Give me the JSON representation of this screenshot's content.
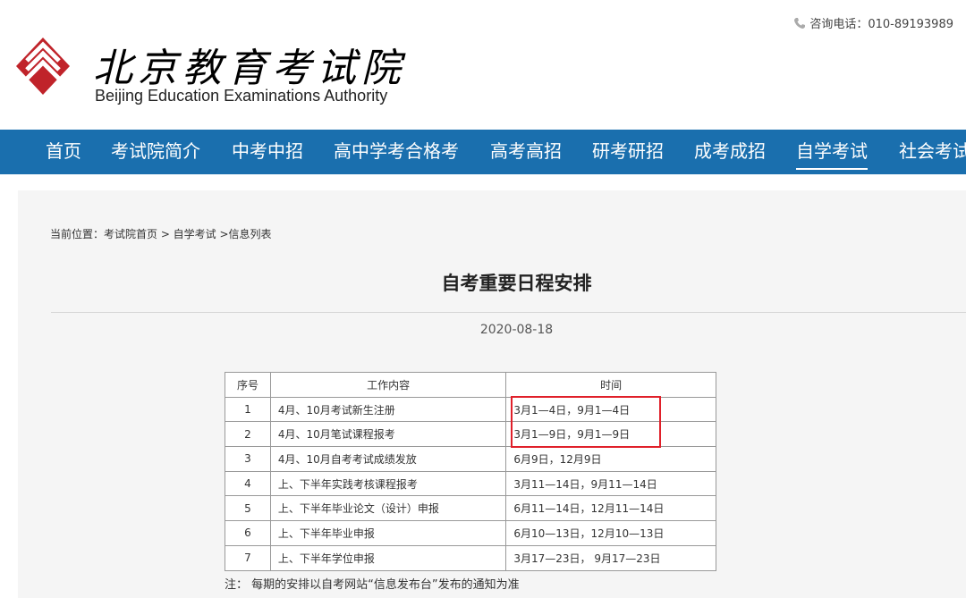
{
  "header": {
    "logo_cn": "北京教育考试院",
    "logo_en": "Beijing Education Examinations Authority",
    "phone": "咨询电话：010-89193989",
    "brand_color": "#c0232a"
  },
  "nav": {
    "items": [
      {
        "label": "首页"
      },
      {
        "label": "考试院简介"
      },
      {
        "label": "中考中招"
      },
      {
        "label": "高中学考合格考"
      },
      {
        "label": "高考高招"
      },
      {
        "label": "研考研招"
      },
      {
        "label": "成考成招"
      },
      {
        "label": "自学考试",
        "active": true
      },
      {
        "label": "社会考试"
      }
    ],
    "color": "#1a6fae"
  },
  "breadcrumb": "当前位置：考试院首页 > 自学考试 >信息列表",
  "article": {
    "title": "自考重要日程安排",
    "date": "2020-08-18"
  },
  "table": {
    "headers": [
      "序号",
      "工作内容",
      "时间"
    ],
    "rows": [
      [
        "1",
        "4月、10月考试新生注册",
        "3月1—4日，9月1—4日"
      ],
      [
        "2",
        "4月、10月笔试课程报考",
        "3月1—9日，9月1—9日"
      ],
      [
        "3",
        "4月、10月自考考试成绩发放",
        "6月9日，12月9日"
      ],
      [
        "4",
        "上、下半年实践考核课程报考",
        "3月11—14日，9月11—14日"
      ],
      [
        "5",
        "上、下半年毕业论文（设计）申报",
        "6月11—14日，12月11—14日"
      ],
      [
        "6",
        "上、下半年毕业申报",
        "6月10—13日，12月10—13日"
      ],
      [
        "7",
        "上、下半年学位申报",
        "3月17—23日， 9月17—23日"
      ]
    ],
    "highlight_color": "#e0202a"
  },
  "note": "注：  每期的安排以自考网站“信息发布台”发布的通知为准"
}
